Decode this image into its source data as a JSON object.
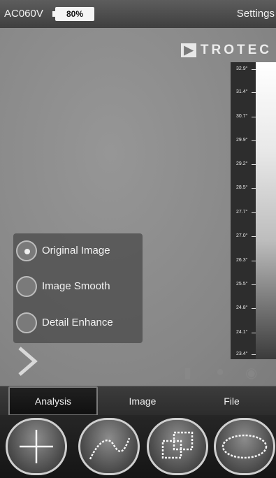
{
  "status_bar": {
    "device_name": "AC060V",
    "battery_percent": "80%",
    "settings_label": "Settings"
  },
  "brand": {
    "mark": "▶",
    "text": "TROTEC"
  },
  "temperature_scale": {
    "labels": [
      "32.9°",
      "31.4°",
      "30.7°",
      "29.9°",
      "29.2°",
      "28.5°",
      "27.7°",
      "27.0°",
      "26.3°",
      "25.5°",
      "24.8°",
      "24.1°",
      "23.4°"
    ],
    "top_color": "#ffffff",
    "bottom_color": "#3b3b3b"
  },
  "image_modes": {
    "options": [
      {
        "label": "Original Image",
        "selected": true
      },
      {
        "label": "Image Smooth",
        "selected": false
      },
      {
        "label": "Detail Enhance",
        "selected": false
      }
    ]
  },
  "tabs": {
    "items": [
      {
        "label": "Analysis",
        "active": true
      },
      {
        "label": "Image",
        "active": false
      },
      {
        "label": "File",
        "active": false
      }
    ]
  },
  "tools": {
    "items": [
      {
        "name": "crosshair-icon"
      },
      {
        "name": "line-icon"
      },
      {
        "name": "rectangle-icon"
      },
      {
        "name": "ellipse-icon"
      }
    ]
  },
  "viewer_icons": [
    "thermometer-icon",
    "flash-icon",
    "camera-icon"
  ]
}
